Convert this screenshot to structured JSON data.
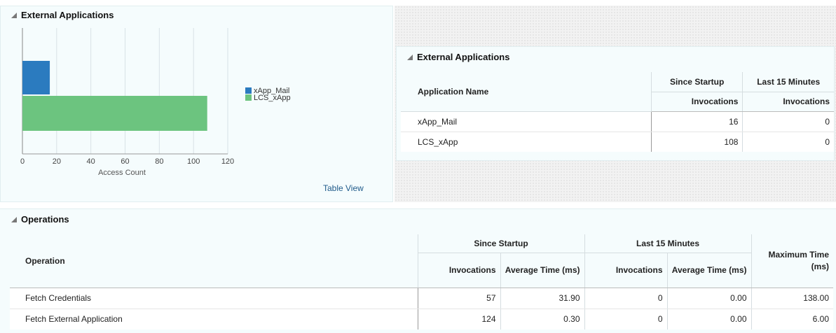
{
  "ext_chart_panel": {
    "title": "External Applications",
    "table_view_link": "Table View"
  },
  "chart_data": {
    "type": "bar",
    "orientation": "horizontal",
    "title": "",
    "xlabel": "Access Count",
    "ylabel": "",
    "xlim": [
      0,
      120
    ],
    "xticks": [
      "0",
      "20",
      "40",
      "60",
      "80",
      "100",
      "120"
    ],
    "categories": [
      "xApp_Mail",
      "LCS_xApp"
    ],
    "series": [
      {
        "name": "xApp_Mail",
        "values": [
          16
        ],
        "color": "#2b7bbf"
      },
      {
        "name": "LCS_xApp",
        "values": [
          108
        ],
        "color": "#6cc47f"
      }
    ],
    "legend_position": "right",
    "grid": true
  },
  "ext_table_panel": {
    "title": "External Applications",
    "headers": {
      "app_name": "Application Name",
      "since_startup": "Since Startup",
      "last_15": "Last 15 Minutes",
      "invocations_1": "Invocations",
      "invocations_2": "Invocations"
    },
    "rows": [
      {
        "name": "xApp_Mail",
        "since": "16",
        "last": "0"
      },
      {
        "name": "LCS_xApp",
        "since": "108",
        "last": "0"
      }
    ]
  },
  "operations": {
    "title": "Operations",
    "headers": {
      "operation": "Operation",
      "since_startup": "Since Startup",
      "last_15": "Last 15 Minutes",
      "max_time": "Maximum Time (ms)",
      "invocations_1": "Invocations",
      "avg_time_1": "Average Time (ms)",
      "invocations_2": "Invocations",
      "avg_time_2": "Average Time (ms)"
    },
    "rows": [
      {
        "op": "Fetch Credentials",
        "inv1": "57",
        "avg1": "31.90",
        "inv2": "0",
        "avg2": "0.00",
        "max": "138.00"
      },
      {
        "op": "Fetch External Application",
        "inv1": "124",
        "avg1": "0.30",
        "inv2": "0",
        "avg2": "0.00",
        "max": "6.00"
      }
    ]
  }
}
